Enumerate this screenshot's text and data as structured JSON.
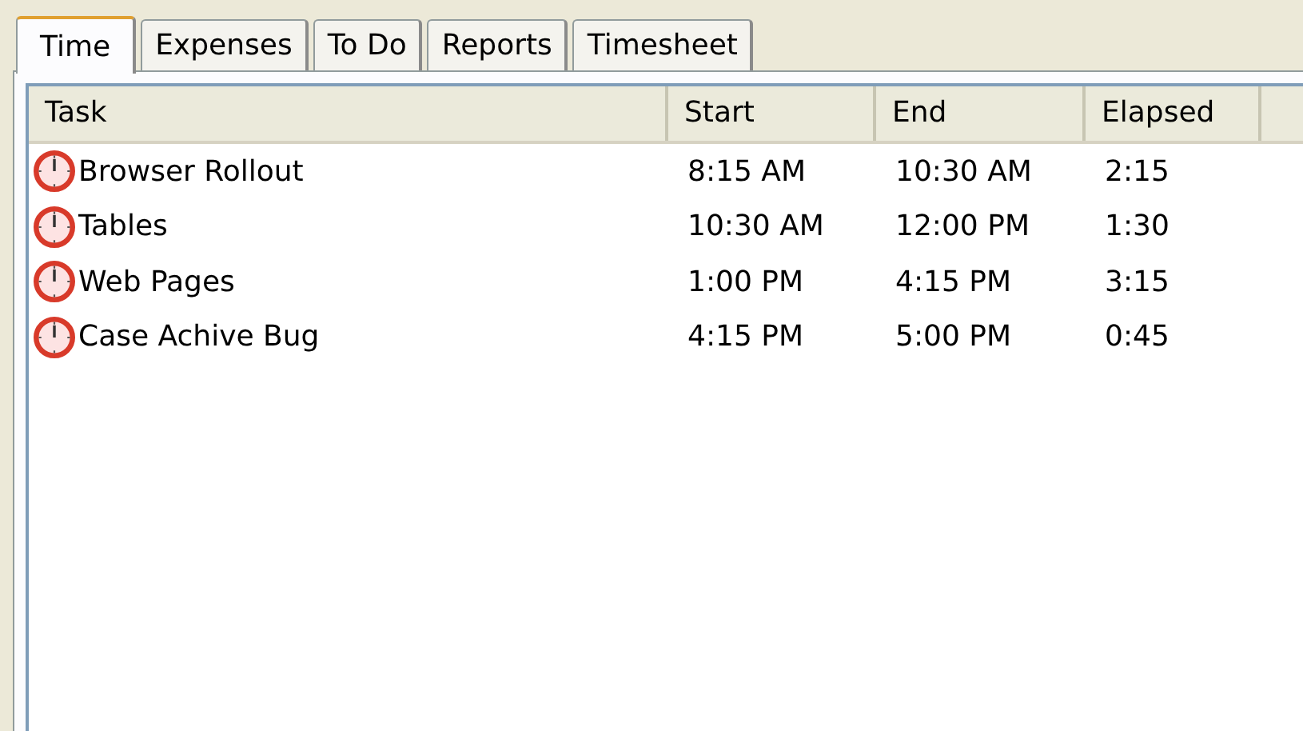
{
  "tabs": [
    {
      "label": "Time",
      "selected": true
    },
    {
      "label": "Expenses",
      "selected": false
    },
    {
      "label": "To Do",
      "selected": false
    },
    {
      "label": "Reports",
      "selected": false
    },
    {
      "label": "Timesheet",
      "selected": false
    }
  ],
  "table": {
    "columns": [
      "Task",
      "Start",
      "End",
      "Elapsed"
    ],
    "rows": [
      [
        "Browser Rollout",
        "8:15 AM",
        "10:30 AM",
        "2:15"
      ],
      [
        "Tables",
        "10:30 AM",
        "12:00 PM",
        "1:30"
      ],
      [
        "Web Pages",
        "1:00 PM",
        "4:15 PM",
        "3:15"
      ],
      [
        "Case Achive Bug",
        "4:15 PM",
        "5:00 PM",
        "0:45"
      ]
    ]
  }
}
